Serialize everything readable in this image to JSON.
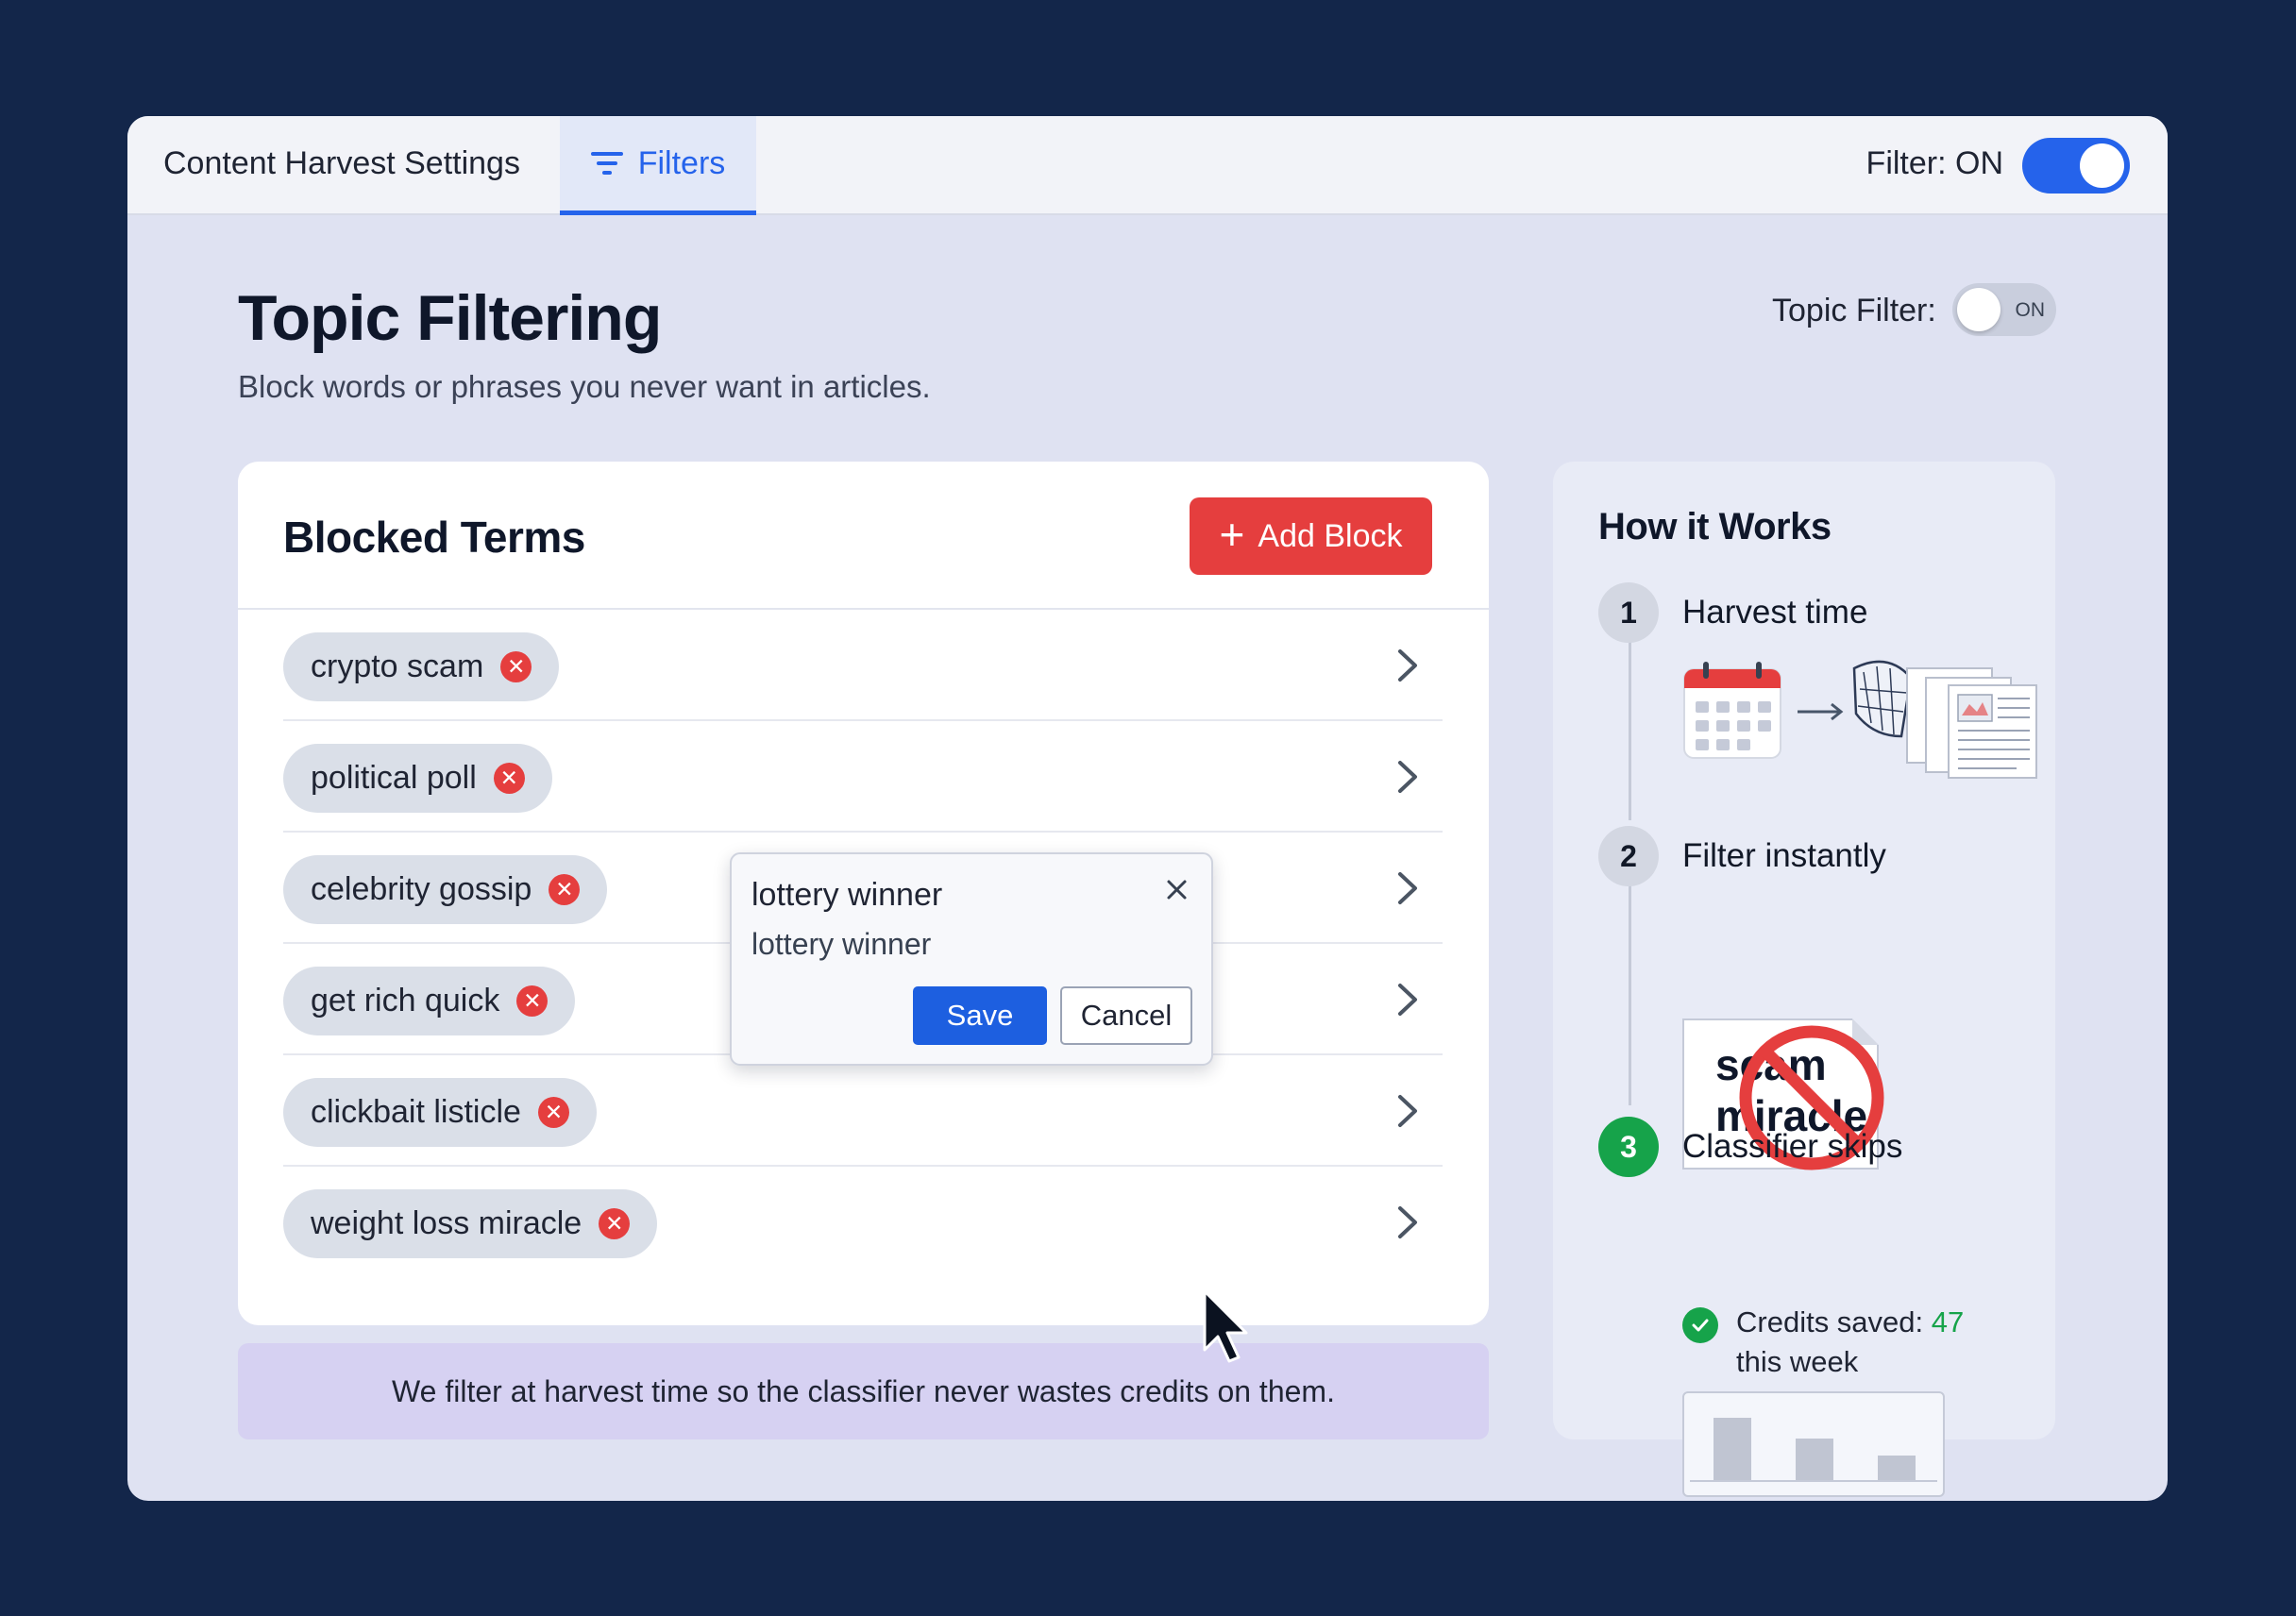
{
  "window": {
    "app_title": "Content Harvest Settings",
    "tab_filters": "Filters",
    "filter_status_label": "Filter: ON",
    "filter_on": true
  },
  "page": {
    "title": "Topic Filtering",
    "subtitle": "Block words or phrases you never want in articles.",
    "topic_filter_label": "Topic Filter:",
    "topic_toggle_text": "ON"
  },
  "blocked": {
    "title": "Blocked Terms",
    "add_button": "Add Block",
    "terms": [
      "crypto scam",
      "political poll",
      "celebrity gossip",
      "get rich quick",
      "clickbait listicle",
      "weight loss miracle"
    ]
  },
  "popup": {
    "title": "lottery winner",
    "value": "lottery winner",
    "save": "Save",
    "cancel": "Cancel"
  },
  "banner": "We filter at harvest time so the classifier never wastes credits on them.",
  "how_it_works": {
    "title": "How it Works",
    "steps": [
      {
        "num": "1",
        "label": "Harvest time"
      },
      {
        "num": "2",
        "label": "Filter instantly"
      },
      {
        "num": "3",
        "label": "Classifier skips"
      }
    ],
    "illustration_words": [
      "scam",
      "miracle"
    ],
    "credits_label": "Credits saved:",
    "credits_value": "47",
    "credits_suffix": "this week",
    "mini_chart_levels": [
      0.82,
      0.55,
      0.32
    ]
  },
  "colors": {
    "accent": "#2563eb",
    "danger": "#e53e3e",
    "success": "#16a34a",
    "background": "#13264a"
  }
}
